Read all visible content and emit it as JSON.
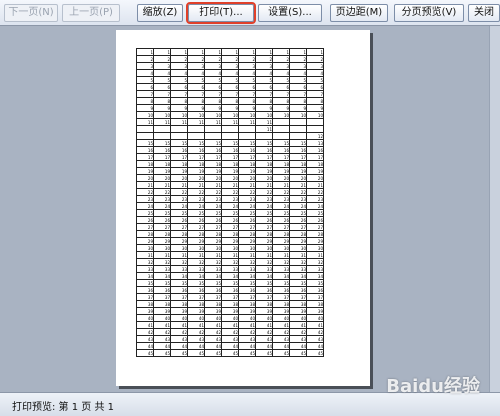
{
  "toolbar": {
    "next_page": "下一页(N)",
    "prev_page": "上一页(P)",
    "zoom": "缩放(Z)",
    "print": "打印(T)...",
    "setup": "设置(S)...",
    "margins": "页边距(M)",
    "page_break_preview": "分页预览(V)",
    "close": "关闭"
  },
  "status": {
    "text": "打印预览: 第 1 页  共 1"
  },
  "watermark": {
    "text": "Baidu经验"
  },
  "sheet": {
    "column_count": 11,
    "rows": [
      "1",
      "2",
      "3",
      "4",
      "5",
      "6",
      "7",
      "8",
      "9",
      "10",
      "11",
      "",
      "",
      "15",
      "16",
      "17",
      "18",
      "19",
      "20",
      "21",
      "22",
      "23",
      "24",
      "25",
      "26",
      "27",
      "28",
      "29",
      "30",
      "31",
      "32",
      "33",
      "34",
      "35",
      "36",
      "37",
      "38",
      "39",
      "40",
      "41",
      "42",
      "43",
      "44",
      "45"
    ],
    "row_overrides": {
      "10": {
        "8": "",
        "9": "",
        "10": ""
      },
      "11": {
        "0": "",
        "1": "",
        "2": "",
        "3": "",
        "4": "",
        "5": "",
        "6": "",
        "7": "11",
        "8": "",
        "9": "",
        "10": ""
      },
      "12": {
        "10": "12"
      },
      "13": {
        "10": "13"
      }
    }
  },
  "colors": {
    "accent": "#e0402a",
    "background": "#a9b3c2"
  }
}
